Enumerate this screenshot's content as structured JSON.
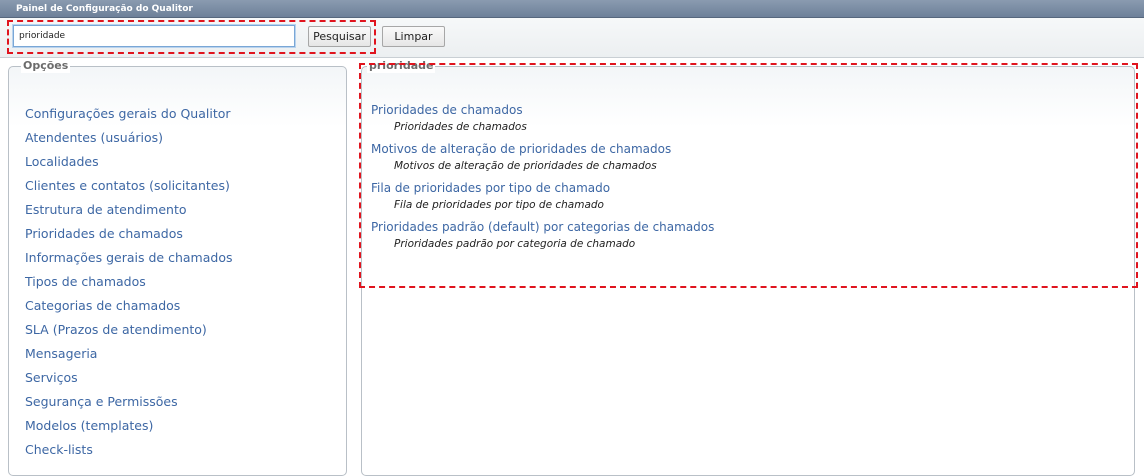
{
  "title_bar": {
    "title": "Painel de Configuração do Qualitor"
  },
  "search": {
    "value": "prioridade",
    "search_button_label": "Pesquisar",
    "clear_button_label": "Limpar"
  },
  "options_panel": {
    "legend": "Opções",
    "items": [
      {
        "label": "Configurações gerais do Qualitor"
      },
      {
        "label": "Atendentes (usuários)"
      },
      {
        "label": "Localidades"
      },
      {
        "label": "Clientes e contatos (solicitantes)"
      },
      {
        "label": "Estrutura de atendimento"
      },
      {
        "label": "Prioridades de chamados"
      },
      {
        "label": "Informações gerais de chamados"
      },
      {
        "label": "Tipos de chamados"
      },
      {
        "label": "Categorias de chamados"
      },
      {
        "label": "SLA (Prazos de atendimento)"
      },
      {
        "label": "Mensageria"
      },
      {
        "label": "Serviços"
      },
      {
        "label": "Segurança e Permissões"
      },
      {
        "label": "Modelos (templates)"
      },
      {
        "label": "Check-lists"
      }
    ]
  },
  "results_panel": {
    "legend": "prioridade",
    "results": [
      {
        "title": "Prioridades de chamados",
        "description": "Prioridades de chamados"
      },
      {
        "title": "Motivos de alteração de prioridades de chamados",
        "description": "Motivos de alteração de prioridades de chamados"
      },
      {
        "title": "Fila de prioridades por tipo de chamado",
        "description": "Fila de prioridades por tipo de chamado"
      },
      {
        "title": "Prioridades padrão (default) por categorias de chamados",
        "description": "Prioridades padrão por categoria de chamado"
      }
    ]
  },
  "colors": {
    "link": "#3d67a4",
    "highlight": "#e0141e",
    "title_bar": "#7a8ba2"
  }
}
